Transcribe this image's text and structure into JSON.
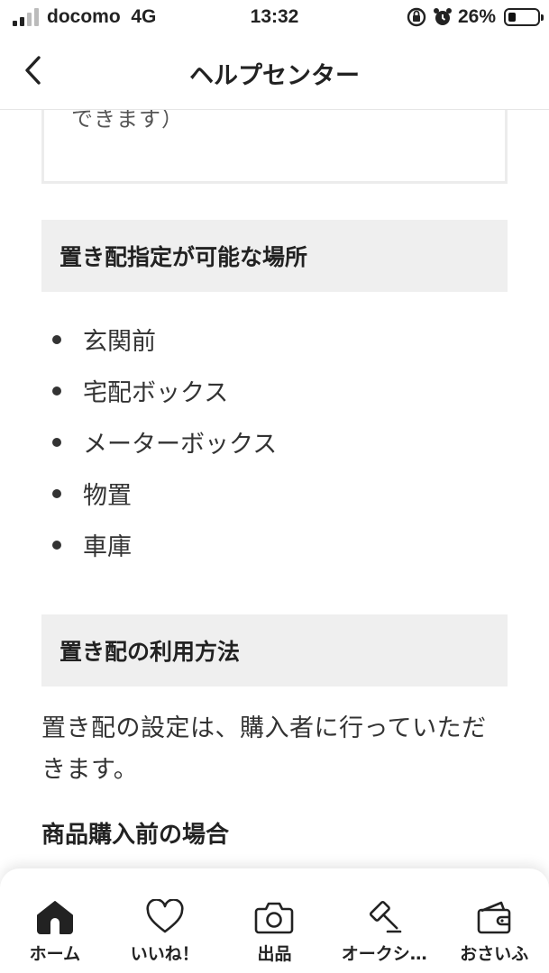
{
  "status_bar": {
    "carrier": "docomo",
    "network": "4G",
    "time": "13:32",
    "battery": "26%",
    "battery_level": 0.26
  },
  "nav": {
    "title": "ヘルプセンター",
    "back_icon": "chevron-left-icon"
  },
  "content": {
    "note_text": "できます）",
    "section1_title": "置き配指定が可能な場所",
    "places": [
      "玄関前",
      "宅配ボックス",
      "メーターボックス",
      "物置",
      "車庫"
    ],
    "section2_title": "置き配の利用方法",
    "paragraph": "置き配の設定は、購入者に行っていただきます。",
    "subheading": "商品購入前の場合"
  },
  "tab_bar": {
    "items": [
      {
        "label": "ホーム",
        "icon": "home-icon"
      },
      {
        "label": "いいね！",
        "icon": "heart-icon"
      },
      {
        "label": "出品",
        "icon": "camera-icon"
      },
      {
        "label": "オークシ…",
        "icon": "gavel-icon"
      },
      {
        "label": "おさいふ",
        "icon": "wallet-icon"
      }
    ]
  }
}
